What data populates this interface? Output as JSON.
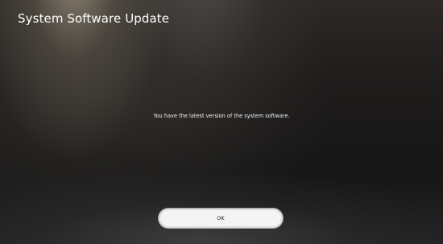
{
  "header": {
    "title": "System Software Update"
  },
  "main": {
    "message": "You have the latest version of the system software."
  },
  "actions": {
    "ok_label": "OK"
  }
}
